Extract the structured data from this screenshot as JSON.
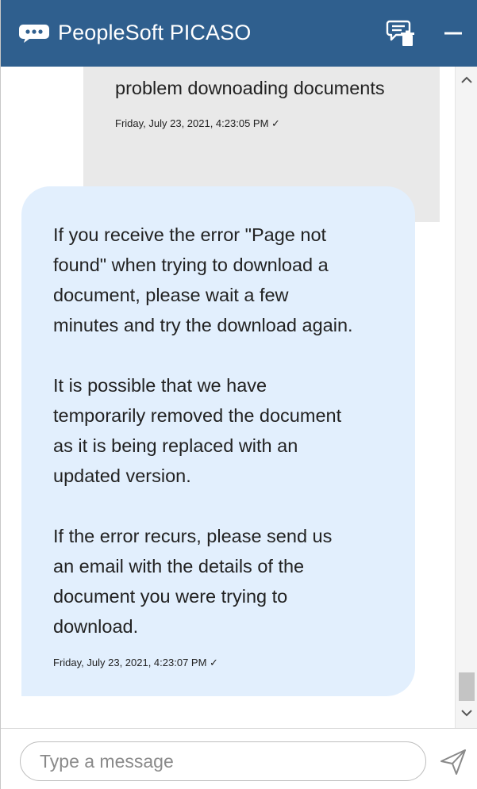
{
  "header": {
    "title": "PeopleSoft PICASO",
    "logo_icon": "chat-bubble-icon",
    "clear_icon": "clear-chat-icon",
    "minimize_icon": "minimize-icon"
  },
  "messages": {
    "user": {
      "text": "problem downoading documents",
      "timestamp": "Friday, July 23, 2021, 4:23:05 PM ✓"
    },
    "bot": {
      "paragraphs": [
        {
          "lines": [
            "If you receive the error \"Page not",
            "found\" when trying to download a",
            "document, please wait a few",
            "minutes and try the download again."
          ]
        },
        {
          "lines": [
            "It is possible that we have",
            "temporarily removed the document",
            "as it is being replaced with an",
            "updated version."
          ]
        },
        {
          "lines": [
            "If the error recurs, please send us",
            "an email with the details of the",
            "document you were trying to",
            "download."
          ]
        }
      ],
      "timestamp": "Friday, July 23, 2021, 4:23:07 PM ✓"
    }
  },
  "composer": {
    "placeholder": "Type a message",
    "value": "",
    "send_icon": "send-icon"
  },
  "colors": {
    "header_bg": "#2f5f8e",
    "user_bubble": "#e9e9e9",
    "bot_bubble": "#e2effd"
  }
}
